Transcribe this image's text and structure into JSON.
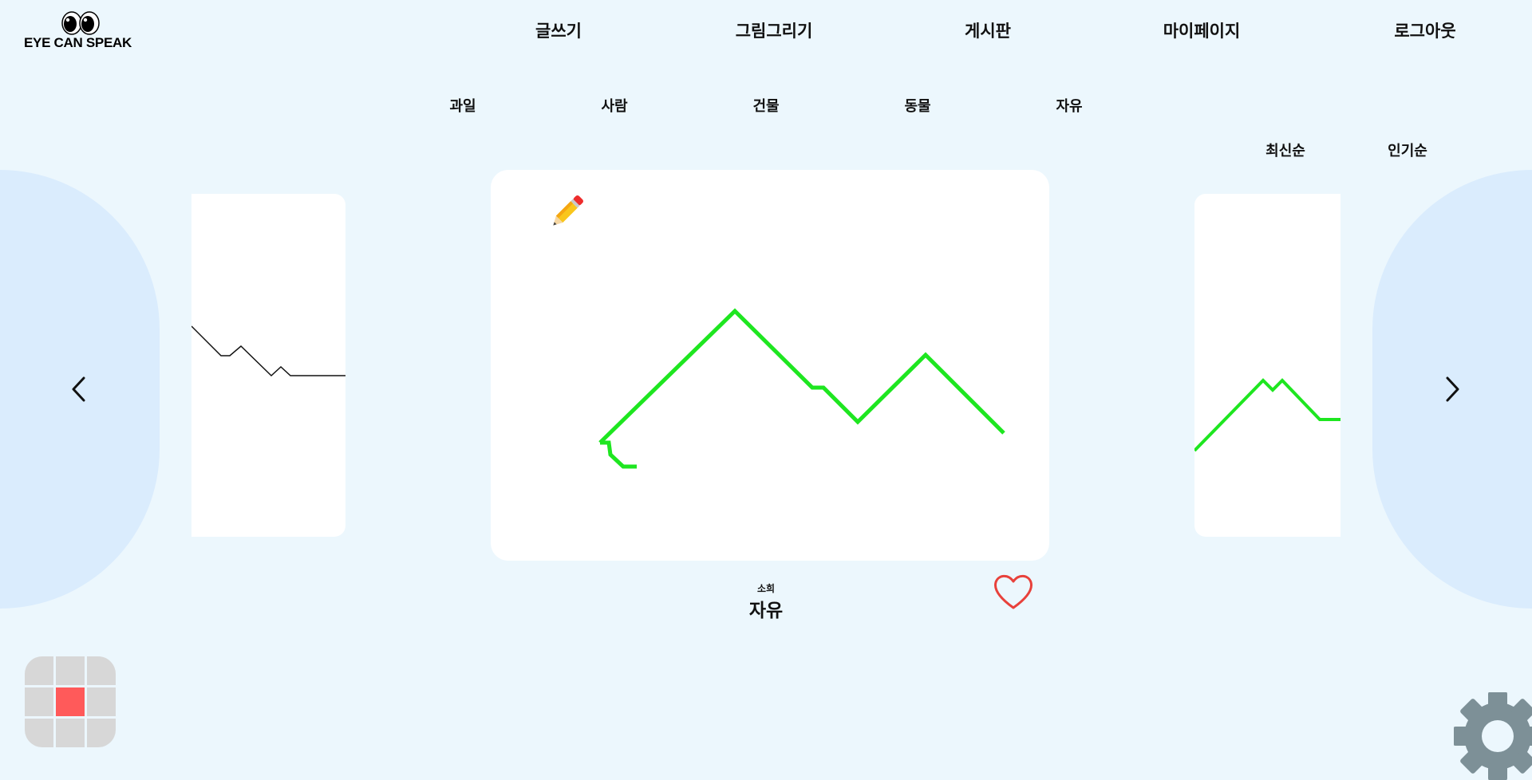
{
  "logo": {
    "text": "EYE CAN SPEAK"
  },
  "nav": {
    "items": [
      {
        "label": "글쓰기"
      },
      {
        "label": "그림그리기"
      },
      {
        "label": "게시판"
      },
      {
        "label": "마이페이지"
      },
      {
        "label": "로그아웃"
      }
    ]
  },
  "categories": {
    "tabs": [
      {
        "label": "과일"
      },
      {
        "label": "사람"
      },
      {
        "label": "건물"
      },
      {
        "label": "동물"
      },
      {
        "label": "자유"
      }
    ]
  },
  "sort": {
    "latest": "최신순",
    "popular": "인기순"
  },
  "post": {
    "author": "소희",
    "title": "자유",
    "liked": false
  },
  "grid_control": {
    "active_cell": 4
  },
  "icons": {
    "prev": "chevron-left-icon",
    "next": "chevron-right-icon",
    "pencil": "pencil-icon",
    "heart": "heart-icon",
    "settings": "gear-icon"
  },
  "colors": {
    "background": "#ecf7fd",
    "side_panel": "#daecfd",
    "drawing_stroke": "#1ee620",
    "heart": "#e8413b",
    "grid_active": "#ff5a5a",
    "grid_cell": "#d7d7d7",
    "gear": "#7d9097"
  }
}
